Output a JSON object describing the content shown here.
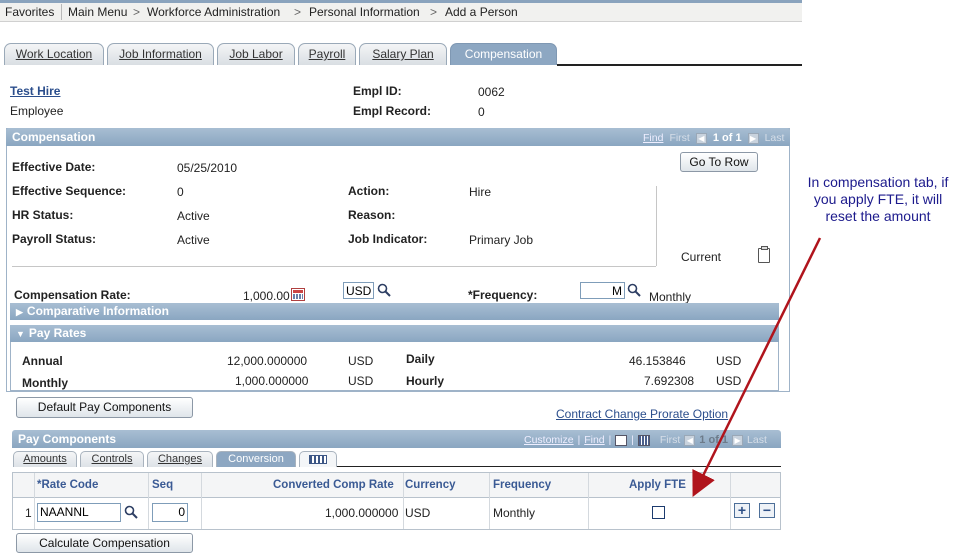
{
  "breadcrumb": {
    "favorites": "Favorites",
    "main_menu": "Main Menu",
    "sep": ">",
    "items": [
      "Workforce Administration",
      "Personal Information",
      "Add a Person"
    ]
  },
  "tabs": [
    {
      "label": "Work Location"
    },
    {
      "label": "Job Information"
    },
    {
      "label": "Job Labor"
    },
    {
      "label": "Payroll"
    },
    {
      "label": "Salary Plan"
    },
    {
      "label": "Compensation"
    }
  ],
  "header": {
    "name": "Test Hire",
    "person_type": "Employee",
    "empl_id_label": "Empl ID:",
    "empl_id": "0062",
    "empl_record_label": "Empl Record:",
    "empl_record": "0"
  },
  "compensation": {
    "title": "Compensation",
    "find": "Find",
    "first": "First",
    "counter": "1 of 1",
    "last": "Last",
    "go_to_row": "Go To Row",
    "effective_date_label": "Effective Date:",
    "effective_date": "05/25/2010",
    "effective_sequence_label": "Effective Sequence:",
    "effective_sequence": "0",
    "action_label": "Action:",
    "action": "Hire",
    "hr_status_label": "HR Status:",
    "hr_status": "Active",
    "reason_label": "Reason:",
    "reason": "",
    "payroll_status_label": "Payroll Status:",
    "payroll_status": "Active",
    "job_indicator_label": "Job Indicator:",
    "job_indicator": "Primary Job",
    "current": "Current",
    "comp_rate_label": "Compensation Rate:",
    "comp_rate": "1,000.00",
    "currency": "USD",
    "frequency_label": "*Frequency:",
    "frequency_code": "M",
    "frequency_desc": "Monthly"
  },
  "comparative": {
    "title": "Comparative Information"
  },
  "pay_rates": {
    "title": "Pay Rates",
    "annual_label": "Annual",
    "annual": "12,000.000000",
    "annual_cur": "USD",
    "monthly_label": "Monthly",
    "monthly": "1,000.000000",
    "monthly_cur": "USD",
    "daily_label": "Daily",
    "daily": "46.153846",
    "daily_cur": "USD",
    "hourly_label": "Hourly",
    "hourly": "7.692308",
    "hourly_cur": "USD"
  },
  "default_pay_button": "Default Pay Components",
  "contract_link": "Contract Change Prorate Option",
  "pay_components": {
    "title": "Pay Components",
    "customize": "Customize",
    "find": "Find",
    "first": "First",
    "counter": "1 of 1",
    "last": "Last",
    "subtabs": [
      "Amounts",
      "Controls",
      "Changes",
      "Conversion"
    ],
    "columns": [
      "*Rate Code",
      "Seq",
      "Converted Comp Rate",
      "Currency",
      "Frequency",
      "Apply FTE"
    ],
    "row": {
      "num": "1",
      "rate_code": "NAANNL",
      "seq": "0",
      "converted": "1,000.000000",
      "currency": "USD",
      "frequency": "Monthly"
    }
  },
  "calc_button": "Calculate Compensation",
  "annotation": "In compensation tab, if you apply FTE, it will reset the amount",
  "colors": {
    "accent": "#8da7c2",
    "annotation": "#1c1a8c",
    "arrow": "#b0141c"
  }
}
